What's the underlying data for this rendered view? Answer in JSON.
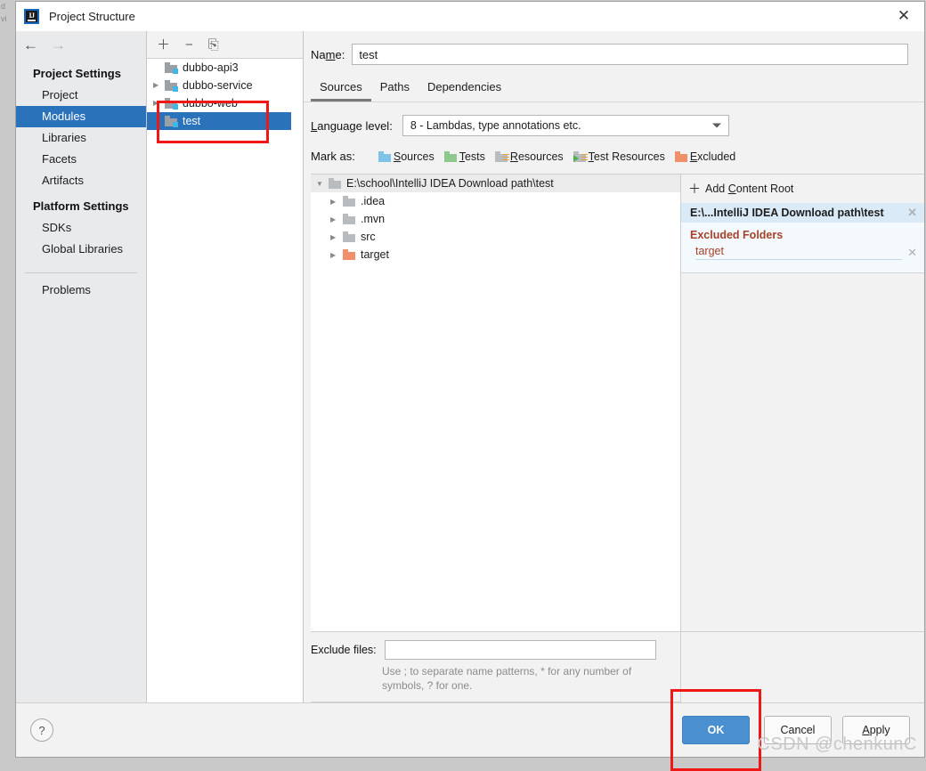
{
  "background_hint": {
    "line1": "d",
    "line2": "vi"
  },
  "window": {
    "title": "Project Structure",
    "logo_text": "IJ",
    "close_icon": "✕"
  },
  "nav": {
    "back_icon": "←",
    "forward_icon": "→",
    "groups": [
      {
        "title": "Project Settings",
        "items": [
          {
            "label": "Project",
            "selected": false
          },
          {
            "label": "Modules",
            "selected": true
          },
          {
            "label": "Libraries",
            "selected": false
          },
          {
            "label": "Facets",
            "selected": false
          },
          {
            "label": "Artifacts",
            "selected": false
          }
        ]
      },
      {
        "title": "Platform Settings",
        "items": [
          {
            "label": "SDKs",
            "selected": false
          },
          {
            "label": "Global Libraries",
            "selected": false
          }
        ]
      }
    ],
    "extra_item": "Problems"
  },
  "modules": {
    "toolbar": {
      "add_icon": "＋",
      "remove_icon": "−",
      "copy_icon": "⎘"
    },
    "items": [
      {
        "label": "dubbo-api3",
        "expandable": false,
        "selected": false
      },
      {
        "label": "dubbo-service",
        "expandable": true,
        "selected": false
      },
      {
        "label": "dubbo-web",
        "expandable": true,
        "selected": false
      },
      {
        "label": "test",
        "expandable": false,
        "selected": true
      }
    ]
  },
  "content": {
    "name_label_pre": "Na",
    "name_label_accel": "m",
    "name_label_post": "e:",
    "name_value": "test",
    "name_placeholder": "",
    "tabs": [
      {
        "label": "Sources",
        "active": true
      },
      {
        "label": "Paths",
        "active": false
      },
      {
        "label": "Dependencies",
        "active": false
      }
    ],
    "language_level": {
      "label_accel": "L",
      "label_rest": "anguage level:",
      "value": "8 - Lambdas, type annotations etc."
    },
    "mark_as": {
      "label": "Mark as:",
      "options": [
        {
          "accel": "S",
          "rest": "ources",
          "kind": "sources",
          "color": "#7fc4e8"
        },
        {
          "accel": "T",
          "rest": "ests",
          "kind": "tests",
          "color": "#8dc98d"
        },
        {
          "accel": "R",
          "rest": "esources",
          "kind": "resources",
          "color": "#b9bcbf"
        },
        {
          "accel": "T",
          "rest": "est Resources",
          "kind": "test-resources",
          "color": "#b9bcbf"
        },
        {
          "accel": "E",
          "rest": "xcluded",
          "kind": "excluded",
          "color": "#f0906b"
        }
      ]
    },
    "tree": {
      "root": {
        "label": "E:\\school\\IntelliJ IDEA Download path\\test",
        "expanded": true
      },
      "children": [
        {
          "label": ".idea",
          "kind": "plain"
        },
        {
          "label": ".mvn",
          "kind": "plain"
        },
        {
          "label": "src",
          "kind": "plain"
        },
        {
          "label": "target",
          "kind": "excluded"
        }
      ]
    },
    "roots_panel": {
      "add_content_root": {
        "plus": "＋",
        "pre": "Add ",
        "accel": "C",
        "post": "ontent Root"
      },
      "content_root_label": "E:\\...IntelliJ IDEA Download path\\test",
      "remove_icon": "✕",
      "excluded_folders_title": "Excluded Folders",
      "excluded_folders": [
        {
          "label": "target"
        }
      ]
    },
    "exclude_files": {
      "label": "Exclude files:",
      "value": "",
      "placeholder": "",
      "hint": "Use ; to separate name patterns, * for any number of symbols, ? for one."
    }
  },
  "footer": {
    "help_icon": "?",
    "ok_label": "OK",
    "cancel_label": "Cancel",
    "apply_accel": "A",
    "apply_rest": "pply"
  },
  "watermark": "CSDN @chenkunC",
  "colors": {
    "selection_blue": "#2a72ba",
    "primary_button": "#4a8fd0",
    "highlight_red": "#f01717",
    "excluded_orange": "#f0906b",
    "excluded_text": "#a5402a",
    "content_root_bg": "#dbeaf7"
  }
}
